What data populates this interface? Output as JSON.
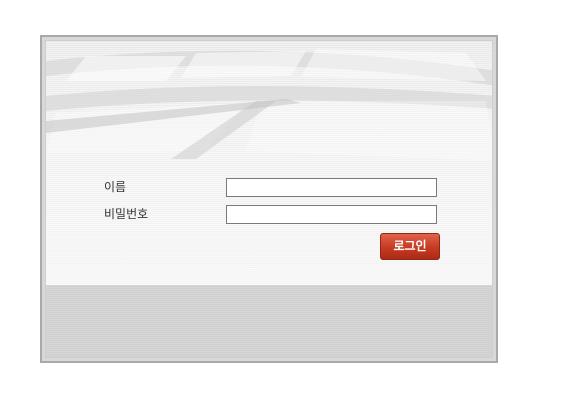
{
  "login_form": {
    "username_label": "이름",
    "password_label": "비밀번호",
    "username_value": "",
    "password_value": "",
    "login_button_label": "로그인"
  },
  "colors": {
    "button_top": "#e1624a",
    "button_bottom": "#ae2a14",
    "frame_border": "#a9a9a9"
  }
}
